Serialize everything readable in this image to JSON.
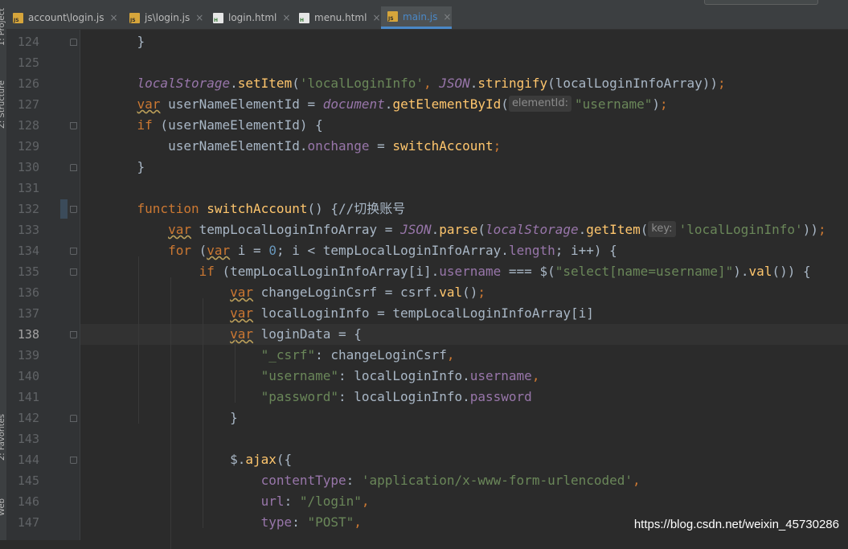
{
  "tool_windows": {
    "project": "1: Project",
    "structure": "Z: Structure",
    "favorites": "2: Favorites",
    "web": "Web"
  },
  "tabs": [
    {
      "name": "account\\login.js",
      "type": "js",
      "icon": "js-file-icon",
      "active": false
    },
    {
      "name": "js\\login.js",
      "type": "js",
      "icon": "js-file-icon",
      "active": false
    },
    {
      "name": "login.html",
      "type": "html",
      "icon": "html-file-icon",
      "active": false
    },
    {
      "name": "menu.html",
      "type": "html",
      "icon": "html-file-icon",
      "active": false
    },
    {
      "name": "main.js",
      "type": "js",
      "icon": "js-file-icon",
      "active": true
    }
  ],
  "icon_labels": {
    "js": "JS",
    "html": "H"
  },
  "close_glyph": "×",
  "current_line": 138,
  "lines": [
    {
      "num": "124",
      "fold": "close",
      "segs": [
        [
          "    ",
          ""
        ],
        [
          "}",
          ""
        ]
      ]
    },
    {
      "num": "125",
      "segs": []
    },
    {
      "num": "126",
      "segs": [
        [
          "    ",
          ""
        ],
        [
          "localStorage",
          "g"
        ],
        [
          ".",
          ""
        ],
        [
          "setItem",
          "f"
        ],
        [
          "(",
          ""
        ],
        [
          "'localLoginInfo'",
          "s"
        ],
        [
          ", ",
          "k"
        ],
        [
          "JSON",
          "g"
        ],
        [
          ".",
          ""
        ],
        [
          "stringify",
          "f"
        ],
        [
          "(localLoginInfoArray))",
          ""
        ],
        [
          ";",
          "k"
        ]
      ]
    },
    {
      "num": "127",
      "segs": [
        [
          "    ",
          ""
        ],
        [
          "var",
          "k u"
        ],
        [
          " userNameElementId = ",
          ""
        ],
        [
          "document",
          "g"
        ],
        [
          ".",
          ""
        ],
        [
          "getElementById",
          "f"
        ],
        [
          "(",
          ""
        ],
        [
          "elementId:",
          "hint"
        ],
        [
          "\"username\"",
          "s"
        ],
        [
          ")",
          ""
        ],
        [
          ";",
          "k"
        ]
      ]
    },
    {
      "num": "128",
      "fold": "open",
      "segs": [
        [
          "    ",
          ""
        ],
        [
          "if",
          "k"
        ],
        [
          " (userNameElementId) {",
          ""
        ]
      ]
    },
    {
      "num": "129",
      "segs": [
        [
          "        userNameElementId.",
          ""
        ],
        [
          "onchange",
          "p"
        ],
        [
          " = ",
          ""
        ],
        [
          "switchAccount",
          "f"
        ],
        [
          ";",
          "k"
        ]
      ]
    },
    {
      "num": "130",
      "fold": "close",
      "segs": [
        [
          "    }",
          ""
        ]
      ]
    },
    {
      "num": "131",
      "segs": []
    },
    {
      "num": "132",
      "fold": "open",
      "segs": [
        [
          "    ",
          ""
        ],
        [
          "function",
          "k"
        ],
        [
          " ",
          ""
        ],
        [
          "switchAccount",
          "f"
        ],
        [
          "() {",
          ""
        ],
        [
          "//切换账号",
          "c"
        ]
      ]
    },
    {
      "num": "133",
      "segs": [
        [
          "        ",
          ""
        ],
        [
          "var",
          "k u"
        ],
        [
          " tempLocalLoginInfoArray = ",
          ""
        ],
        [
          "JSON",
          "g"
        ],
        [
          ".",
          ""
        ],
        [
          "parse",
          "f"
        ],
        [
          "(",
          ""
        ],
        [
          "localStorage",
          "g"
        ],
        [
          ".",
          ""
        ],
        [
          "getItem",
          "f"
        ],
        [
          "(",
          ""
        ],
        [
          "key:",
          "hint"
        ],
        [
          "'localLoginInfo'",
          "s"
        ],
        [
          "))",
          ""
        ],
        [
          ";",
          "k"
        ]
      ]
    },
    {
      "num": "134",
      "fold": "open",
      "segs": [
        [
          "        ",
          ""
        ],
        [
          "for",
          "k"
        ],
        [
          " (",
          ""
        ],
        [
          "var",
          "k u"
        ],
        [
          " i = ",
          ""
        ],
        [
          "0",
          "n"
        ],
        [
          "; i < tempLocalLoginInfoArray.",
          ""
        ],
        [
          "length",
          "p"
        ],
        [
          "; i++) {",
          ""
        ]
      ]
    },
    {
      "num": "135",
      "fold": "open",
      "segs": [
        [
          "            ",
          ""
        ],
        [
          "if",
          "k"
        ],
        [
          " (tempLocalLoginInfoArray[i].",
          ""
        ],
        [
          "username",
          "p"
        ],
        [
          " === $(",
          ""
        ],
        [
          "\"select[",
          "s"
        ],
        [
          "name=username",
          "s"
        ],
        [
          "]\"",
          "s"
        ],
        [
          ").",
          ""
        ],
        [
          "val",
          "f"
        ],
        [
          "()) {",
          ""
        ]
      ]
    },
    {
      "num": "136",
      "segs": [
        [
          "                ",
          ""
        ],
        [
          "var",
          "k u"
        ],
        [
          " changeLoginCsrf = csrf.",
          ""
        ],
        [
          "val",
          "f"
        ],
        [
          "()",
          ""
        ],
        [
          ";",
          "k"
        ]
      ]
    },
    {
      "num": "137",
      "segs": [
        [
          "                ",
          ""
        ],
        [
          "var",
          "k u"
        ],
        [
          " localLoginInfo = tempLocalLoginInfoArray[i]",
          ""
        ]
      ]
    },
    {
      "num": "138",
      "fold": "open",
      "segs": [
        [
          "                ",
          ""
        ],
        [
          "var",
          "k u"
        ],
        [
          " loginData = {",
          ""
        ]
      ]
    },
    {
      "num": "139",
      "segs": [
        [
          "                    ",
          ""
        ],
        [
          "\"_csrf\"",
          "s"
        ],
        [
          ": changeLoginCsrf",
          ""
        ],
        [
          ",",
          "k"
        ]
      ]
    },
    {
      "num": "140",
      "segs": [
        [
          "                    ",
          ""
        ],
        [
          "\"username\"",
          "s"
        ],
        [
          ": localLoginInfo.",
          ""
        ],
        [
          "username",
          "p"
        ],
        [
          ",",
          "k"
        ]
      ]
    },
    {
      "num": "141",
      "segs": [
        [
          "                    ",
          ""
        ],
        [
          "\"password\"",
          "s"
        ],
        [
          ": localLoginInfo.",
          ""
        ],
        [
          "password",
          "p"
        ]
      ]
    },
    {
      "num": "142",
      "fold": "close",
      "segs": [
        [
          "                }",
          ""
        ]
      ]
    },
    {
      "num": "143",
      "segs": []
    },
    {
      "num": "144",
      "fold": "open",
      "segs": [
        [
          "                $.",
          ""
        ],
        [
          "ajax",
          "f"
        ],
        [
          "({",
          ""
        ]
      ]
    },
    {
      "num": "145",
      "segs": [
        [
          "                    ",
          ""
        ],
        [
          "contentType",
          "p"
        ],
        [
          ": ",
          ""
        ],
        [
          "'application/x-www-form-urlencoded'",
          "s"
        ],
        [
          ",",
          "k"
        ]
      ]
    },
    {
      "num": "146",
      "segs": [
        [
          "                    ",
          ""
        ],
        [
          "url",
          "p"
        ],
        [
          ": ",
          ""
        ],
        [
          "\"/login\"",
          "s"
        ],
        [
          ",",
          "k"
        ]
      ]
    },
    {
      "num": "147",
      "segs": [
        [
          "                    ",
          ""
        ],
        [
          "type",
          "p"
        ],
        [
          ": ",
          ""
        ],
        [
          "\"POST\"",
          "s"
        ],
        [
          ",",
          "k"
        ]
      ]
    }
  ],
  "watermark": "https://blog.csdn.net/weixin_45730286"
}
